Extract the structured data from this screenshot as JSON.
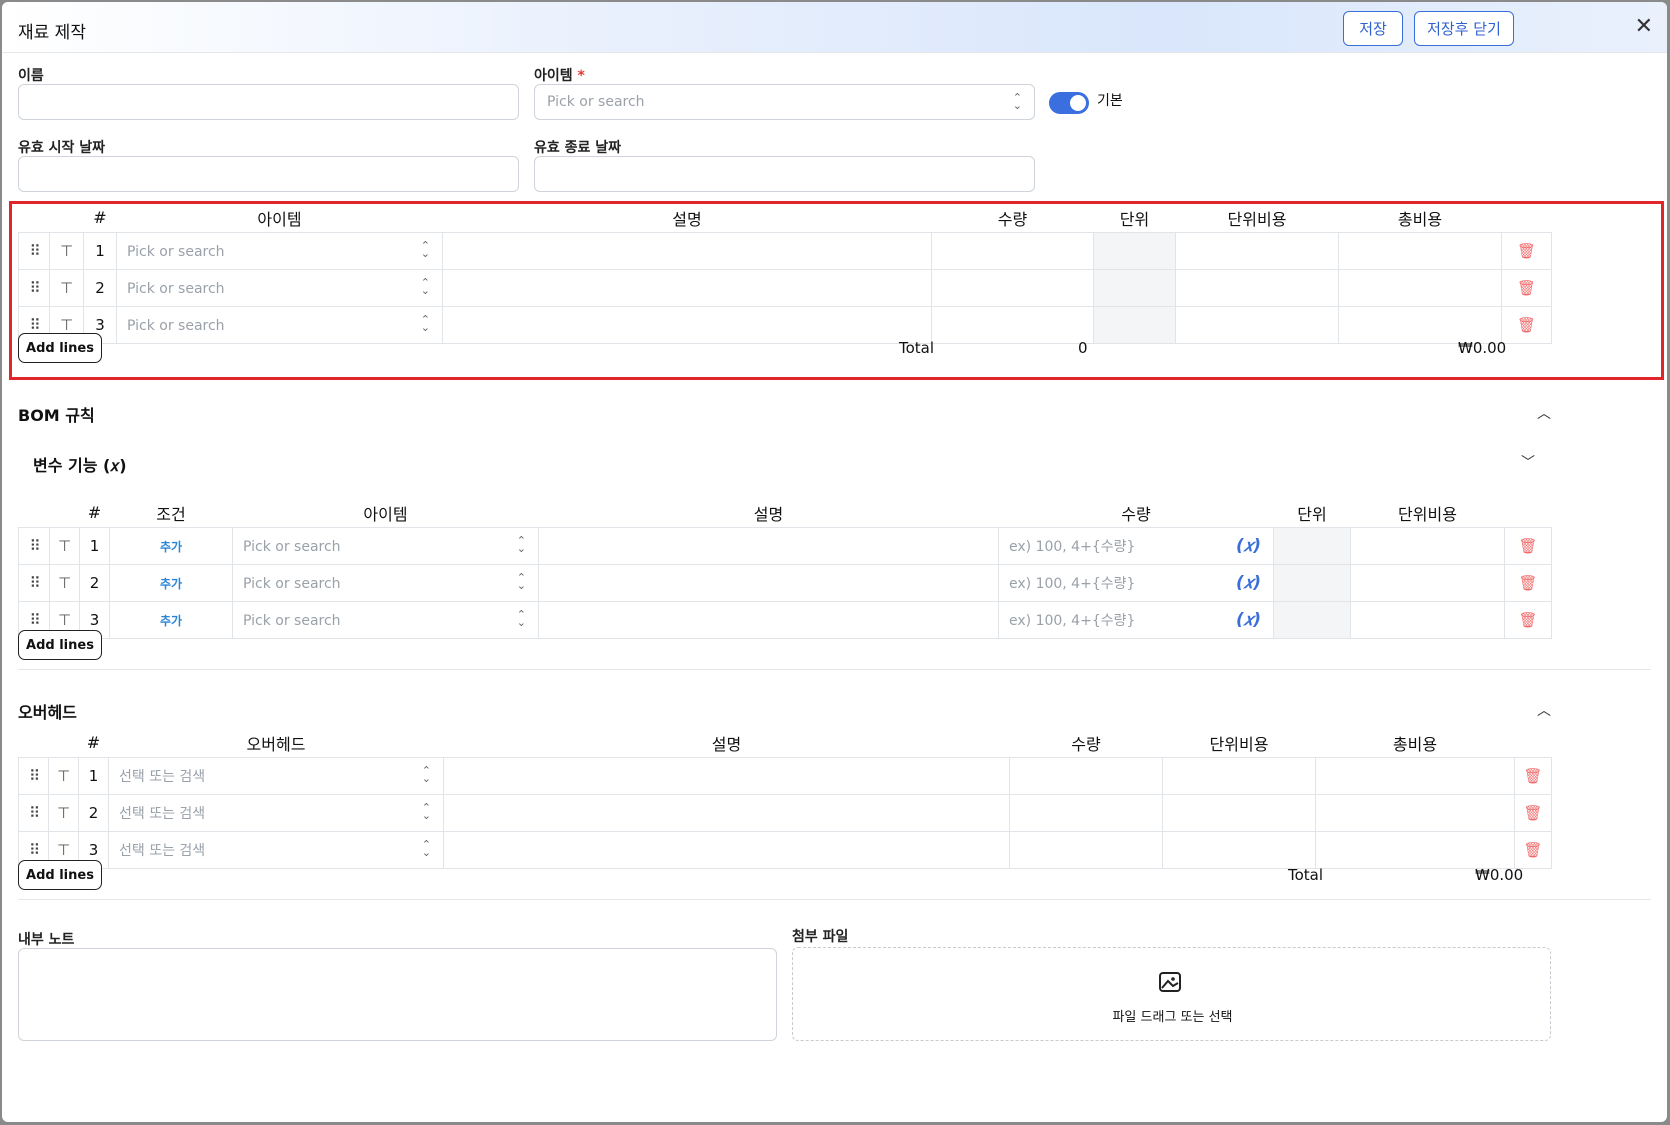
{
  "header": {
    "title": "재료 제작",
    "save": "저장",
    "save_close": "저장후 닫기",
    "close_icon": "close-icon"
  },
  "form": {
    "name_label": "이름",
    "item_label": "아이템",
    "item_required": "*",
    "item_placeholder": "Pick or search",
    "default_label": "기본",
    "default_on": true,
    "start_label": "유효 시작 날짜",
    "end_label": "유효 종료 날짜"
  },
  "materials": {
    "columns": [
      "#",
      "아이템",
      "설명",
      "수량",
      "단위",
      "단위비용",
      "총비용"
    ],
    "rows": [
      {
        "no": "1",
        "item": "Pick or search"
      },
      {
        "no": "2",
        "item": "Pick or search"
      },
      {
        "no": "3",
        "item": "Pick or search"
      }
    ],
    "add_lines": "Add lines",
    "total_label": "Total",
    "total_qty": "0",
    "total_cost": "₩0.00"
  },
  "bom": {
    "title": "BOM 규칙",
    "variable_title": "변수 기능 (𝑥)",
    "columns": [
      "#",
      "조건",
      "아이템",
      "설명",
      "수량",
      "단위",
      "단위비용"
    ],
    "rows": [
      {
        "no": "1",
        "cond": "추가",
        "item": "Pick or search",
        "qty": "ex) 100, 4+{수량}"
      },
      {
        "no": "2",
        "cond": "추가",
        "item": "Pick or search",
        "qty": "ex) 100, 4+{수량}"
      },
      {
        "no": "3",
        "cond": "추가",
        "item": "Pick or search",
        "qty": "ex) 100, 4+{수량}"
      }
    ],
    "fx_label": "(𝑥)",
    "add_lines": "Add lines"
  },
  "overhead": {
    "title": "오버헤드",
    "columns": [
      "#",
      "오버헤드",
      "설명",
      "수량",
      "단위비용",
      "총비용"
    ],
    "rows": [
      {
        "no": "1",
        "item": "선택 또는 검색"
      },
      {
        "no": "2",
        "item": "선택 또는 검색"
      },
      {
        "no": "3",
        "item": "선택 또는 검색"
      }
    ],
    "add_lines": "Add lines",
    "total_label": "Total",
    "total_cost": "₩0.00"
  },
  "notes": {
    "label": "내부 노트"
  },
  "attachments": {
    "label": "첨부 파일",
    "drop_text": "파일 드래그 또는 선택",
    "icon": "image-icon"
  },
  "colors": {
    "accent": "#3b6fe0",
    "danger": "#f06b6b",
    "highlight": "#e0262a"
  }
}
